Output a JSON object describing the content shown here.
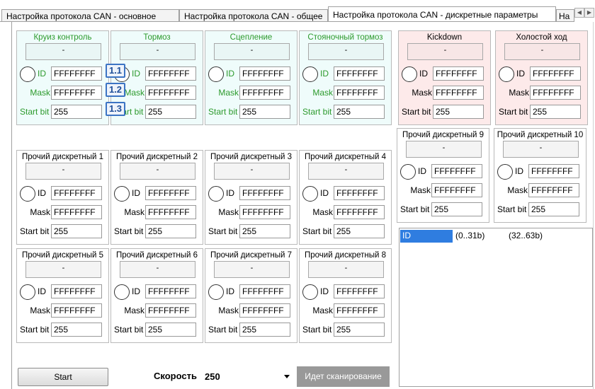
{
  "tabs": [
    "Настройка протокола CAN - основное",
    "Настройка протокола CAN - общее",
    "Настройка протокола CAN - дискретные параметры",
    "На"
  ],
  "active_tab": 2,
  "labels": {
    "id": "ID",
    "mask": "Mask",
    "start_bit": "Start bit"
  },
  "panels": [
    {
      "title": "Круиз контроль",
      "value": "-",
      "id": "FFFFFFFF",
      "mask": "FFFFFFFF",
      "start": "255"
    },
    {
      "title": "Тормоз",
      "value": "-",
      "id": "FFFFFFFF",
      "mask": "FFFFFFFF",
      "start": "255"
    },
    {
      "title": "Сцепление",
      "value": "-",
      "id": "FFFFFFFF",
      "mask": "FFFFFFFF",
      "start": "255"
    },
    {
      "title": "Стояночный тормоз",
      "value": "-",
      "id": "FFFFFFFF",
      "mask": "FFFFFFFF",
      "start": "255"
    },
    {
      "title": "Kickdown",
      "value": "-",
      "id": "FFFFFFFF",
      "mask": "FFFFFFFF",
      "start": "255"
    },
    {
      "title": "Холостой ход",
      "value": "-",
      "id": "FFFFFFFF",
      "mask": "FFFFFFFF",
      "start": "255"
    },
    {
      "title": "Прочий дискретный 1",
      "value": "-",
      "id": "FFFFFFFF",
      "mask": "FFFFFFFF",
      "start": "255"
    },
    {
      "title": "Прочий дискретный 2",
      "value": "-",
      "id": "FFFFFFFF",
      "mask": "FFFFFFFF",
      "start": "255"
    },
    {
      "title": "Прочий дискретный 3",
      "value": "-",
      "id": "FFFFFFFF",
      "mask": "FFFFFFFF",
      "start": "255"
    },
    {
      "title": "Прочий дискретный 4",
      "value": "-",
      "id": "FFFFFFFF",
      "mask": "FFFFFFFF",
      "start": "255"
    },
    {
      "title": "Прочий дискретный 9",
      "value": "-",
      "id": "FFFFFFFF",
      "mask": "FFFFFFFF",
      "start": "255"
    },
    {
      "title": "Прочий дискретный 10",
      "value": "-",
      "id": "FFFFFFFF",
      "mask": "FFFFFFFF",
      "start": "255"
    },
    {
      "title": "Прочий дискретный 5",
      "value": "-",
      "id": "FFFFFFFF",
      "mask": "FFFFFFFF",
      "start": "255"
    },
    {
      "title": "Прочий дискретный 6",
      "value": "-",
      "id": "FFFFFFFF",
      "mask": "FFFFFFFF",
      "start": "255"
    },
    {
      "title": "Прочий дискретный 7",
      "value": "-",
      "id": "FFFFFFFF",
      "mask": "FFFFFFFF",
      "start": "255"
    },
    {
      "title": "Прочий дискретный 8",
      "value": "-",
      "id": "FFFFFFFF",
      "mask": "FFFFFFFF",
      "start": "255"
    }
  ],
  "callouts": [
    "1.1",
    "1.2",
    "1.3"
  ],
  "footer": {
    "start_button": "Start",
    "speed_label": "Скорость",
    "speed_value": "250",
    "scan_status": "Идет сканирование"
  },
  "id_table": {
    "columns": [
      "ID",
      "(0..31b)",
      "(32..63b)"
    ]
  },
  "colors": {
    "accent_selection": "#2f7de0",
    "cyan_panel": "#effcfb",
    "pink_panel": "#fdeaea",
    "panel_title_green": "#2c9a2c",
    "status_bg": "#999999"
  }
}
